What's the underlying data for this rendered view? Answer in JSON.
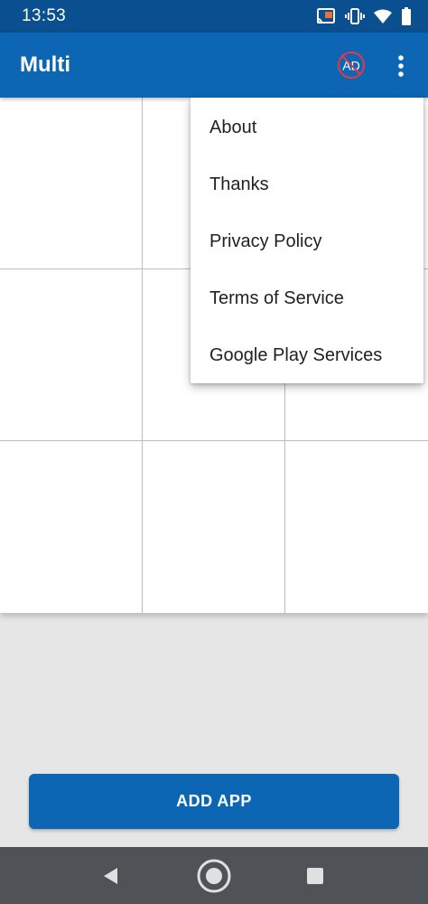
{
  "status_bar": {
    "time": "13:53",
    "icons": [
      "cast-icon",
      "vibrate-icon",
      "wifi-icon",
      "battery-icon"
    ]
  },
  "app_bar": {
    "title": "Multi",
    "ad_badge_text": "AD",
    "color": "#0d66b3"
  },
  "menu": {
    "items": [
      {
        "label": "About"
      },
      {
        "label": "Thanks"
      },
      {
        "label": "Privacy Policy"
      },
      {
        "label": "Terms of Service"
      },
      {
        "label": "Google Play Services"
      }
    ]
  },
  "add_button": {
    "label": "ADD APP"
  },
  "nav_bar": {
    "icons": [
      "back-icon",
      "home-icon",
      "recents-icon"
    ]
  },
  "colors": {
    "accent": "#0d66b3",
    "status_bar": "#0a4f8f",
    "nav_bar": "#4f5257",
    "background": "#e6e6e6",
    "ad_badge": "#e53945"
  }
}
